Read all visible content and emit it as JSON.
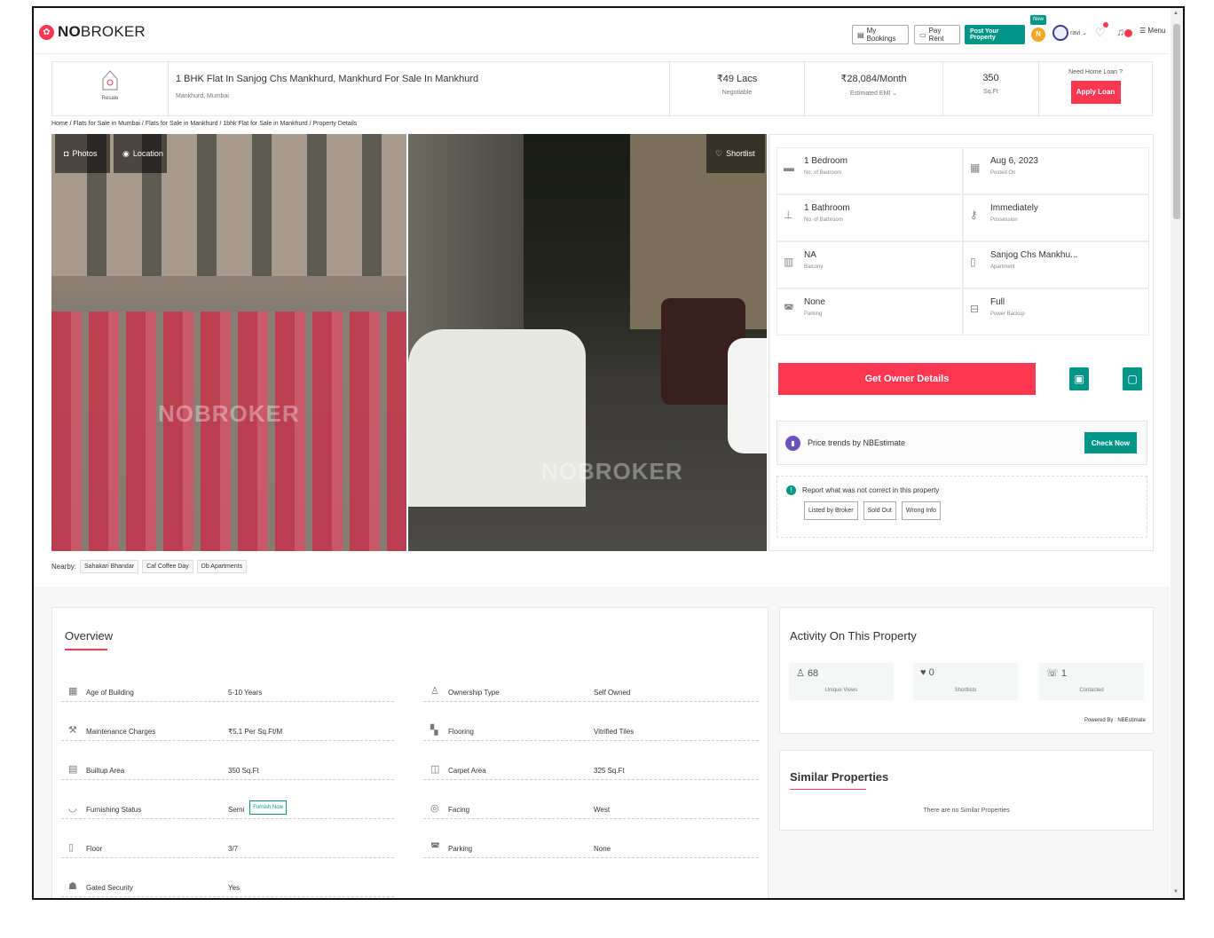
{
  "brand": {
    "logo_no": "NO",
    "logo_rest": "BROKER"
  },
  "topbar": {
    "my_bookings": "My Bookings",
    "pay_rent": "Pay Rent",
    "post_property": "Post Your Property",
    "new_badge": "New",
    "user_name": "ravi",
    "menu": "Menu",
    "badge_n": "N"
  },
  "header": {
    "category": "Resale",
    "title": "1 BHK Flat In Sanjog Chs Mankhurd, Mankhurd For Sale In Mankhurd",
    "location": "Mankhurd, Mumbai",
    "price": "₹49 Lacs",
    "price_sub": "Negotiable",
    "emi": "₹28,084/Month",
    "emi_sub": "Estimated EMI",
    "area": "350",
    "area_sub": "Sq.Ft",
    "loan_question": "Need Home Loan ?",
    "apply_loan": "Apply Loan"
  },
  "breadcrumb": "Home / Flats for Sale in Mumbai / Flats for Sale in Mankhurd / 1bhk Flat for Sale in Mankhurd / Property Details",
  "gallery": {
    "photos": "Photos",
    "location": "Location",
    "shortlist": "Shortlist",
    "watermark": "NOBROKER"
  },
  "nearby": {
    "label": "Nearby:",
    "items": [
      "Sahakari Bhandar",
      "Caf Coffee Day",
      "Db Apartments"
    ]
  },
  "details": [
    {
      "value": "1 Bedroom",
      "label": "No. of Bedroom",
      "icon": "bed-icon"
    },
    {
      "value": "Aug 6, 2023",
      "label": "Posted On",
      "icon": "calendar-icon"
    },
    {
      "value": "1 Bathroom",
      "label": "No. of Bathroom",
      "icon": "shower-icon"
    },
    {
      "value": "Immediately",
      "label": "Possession",
      "icon": "key-icon"
    },
    {
      "value": "NA",
      "label": "Balcony",
      "icon": "balcony-icon"
    },
    {
      "value": "Sanjog Chs Mankhu...",
      "label": "Apartment",
      "icon": "building-icon"
    },
    {
      "value": "None",
      "label": "Parking",
      "icon": "car-icon"
    },
    {
      "value": "Full",
      "label": "Power Backup",
      "icon": "battery-icon"
    }
  ],
  "actions": {
    "get_owner": "Get Owner Details"
  },
  "price_trends": {
    "text": "Price trends by NBEstimate",
    "button": "Check Now"
  },
  "report": {
    "title": "Report what was not correct in this property",
    "buttons": [
      "Listed by Broker",
      "Sold Out",
      "Wrong Info"
    ]
  },
  "overview": {
    "title": "Overview",
    "left": [
      {
        "label": "Age of Building",
        "value": "5-10 Years"
      },
      {
        "label": "Maintenance Charges",
        "value": "₹5.1 Per Sq.Ft/M"
      },
      {
        "label": "Builtup Area",
        "value": "350 Sq.Ft"
      },
      {
        "label": "Furnishing Status",
        "value": "Semi"
      },
      {
        "label": "Floor",
        "value": "3/7"
      },
      {
        "label": "Gated Security",
        "value": "Yes"
      }
    ],
    "right": [
      {
        "label": "Ownership Type",
        "value": "Self Owned"
      },
      {
        "label": "Flooring",
        "value": "Vitrified Tiles"
      },
      {
        "label": "Carpet Area",
        "value": "325 Sq.Ft"
      },
      {
        "label": "Facing",
        "value": "West"
      },
      {
        "label": "Parking",
        "value": "None"
      }
    ],
    "furnish_now": "Furnish Now"
  },
  "activity": {
    "title": "Activity On This Property",
    "stats": [
      {
        "value": "68",
        "label": "Unique Views"
      },
      {
        "value": "0",
        "label": "Shortlists"
      },
      {
        "value": "1",
        "label": "Contacted"
      }
    ],
    "powered": "Powered By : NBEstimate"
  },
  "similar": {
    "title": "Similar Properties",
    "empty": "There are no Similar Properties"
  },
  "colors": {
    "brand": "#fd3752",
    "accent": "#009587"
  }
}
